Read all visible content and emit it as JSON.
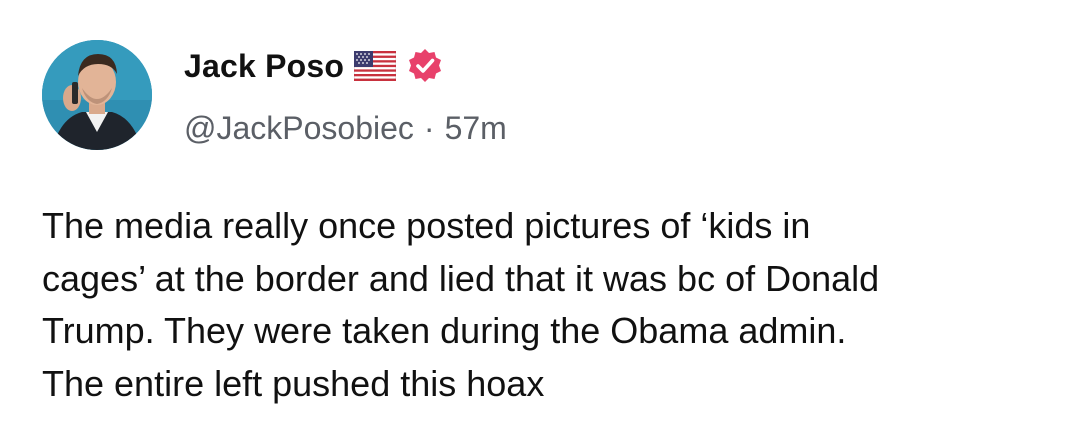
{
  "author": {
    "display_name": "Jack Poso",
    "handle": "@JackPosobiec",
    "avatar_icon": "profile-photo",
    "flag_icon": "us-flag-icon",
    "verified_icon": "verified-badge-icon",
    "verified_color": "#e8416b"
  },
  "meta": {
    "separator": "·",
    "time_ago": "57m"
  },
  "post": {
    "text": "The media really once posted pictures of ‘kids in\ncages’ at the border and lied that it was bc of Donald\nTrump. They were taken during the Obama admin.\nThe entire left pushed this hoax"
  }
}
